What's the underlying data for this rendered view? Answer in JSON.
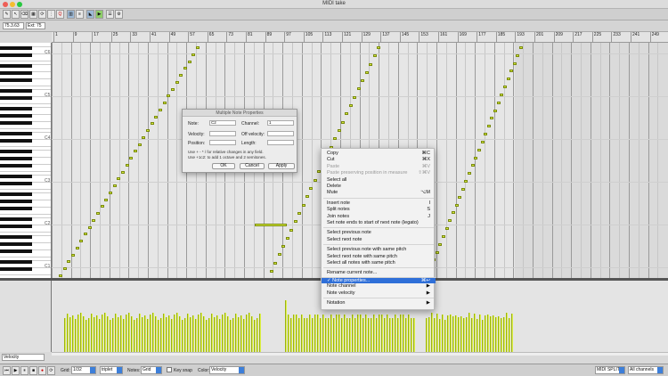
{
  "window": {
    "title": "MIDI take"
  },
  "infobar": {
    "position": "75.3.63",
    "length": "Ext: 75"
  },
  "ruler": {
    "labels": [
      "1",
      "9",
      "17",
      "25",
      "33",
      "41",
      "49",
      "57",
      "65",
      "73",
      "81",
      "89",
      "97",
      "105",
      "113",
      "121",
      "129",
      "137",
      "145",
      "153",
      "161",
      "169",
      "177",
      "185",
      "193",
      "201",
      "209",
      "217",
      "225",
      "233",
      "241",
      "249"
    ]
  },
  "piano": {
    "octaves": [
      "C6",
      "C5",
      "C4",
      "C3",
      "C2",
      "C1"
    ]
  },
  "dialog": {
    "title": "Multiple Note Properties",
    "note_label": "Note:",
    "note_value": "C2",
    "channel_label": "Channel:",
    "channel_value": "1",
    "velocity_label": "Velocity:",
    "off_velocity_label": "Off velocity:",
    "position_label": "Position:",
    "length_label": "Length:",
    "hint1": "Use + - * / for relative changes in any field.",
    "hint2": "Use +1c2: to add 1 octave and 2 semitones.",
    "ok": "OK",
    "cancel": "Cancel",
    "apply": "Apply"
  },
  "menu": {
    "items": [
      {
        "label": "Copy",
        "shortcut": "⌘C"
      },
      {
        "label": "Cut",
        "shortcut": "⌘X"
      },
      {
        "label": "Paste",
        "shortcut": "⌘V",
        "disabled": true
      },
      {
        "label": "Paste preserving position in measure",
        "shortcut": "⇧⌘V",
        "disabled": true
      },
      {
        "label": "Select all",
        "shortcut": ""
      },
      {
        "label": "Delete",
        "shortcut": ""
      },
      {
        "label": "Mute",
        "shortcut": "⌥M"
      },
      {
        "label": "Insert note",
        "shortcut": "I"
      },
      {
        "label": "Split notes",
        "shortcut": "S"
      },
      {
        "label": "Join notes",
        "shortcut": "J"
      },
      {
        "label": "Set note ends to start of next note (legato)",
        "shortcut": ""
      },
      {
        "label": "Select previous note",
        "shortcut": ""
      },
      {
        "label": "Select next note",
        "shortcut": ""
      },
      {
        "label": "Select previous note with same pitch",
        "shortcut": ""
      },
      {
        "label": "Select next note with same pitch",
        "shortcut": ""
      },
      {
        "label": "Select all notes with same pitch",
        "shortcut": ""
      },
      {
        "label": "Rename current note...",
        "shortcut": ""
      },
      {
        "label": "✓ Note properties...",
        "shortcut": "⌘↩",
        "highlighted": true
      },
      {
        "label": "Note channel",
        "shortcut": "▶"
      },
      {
        "label": "Note velocity",
        "shortcut": "▶"
      },
      {
        "label": "Notation",
        "shortcut": "▶"
      }
    ]
  },
  "velocity_lane": {
    "label": "Velocity"
  },
  "bottombar": {
    "grid_label": "Grid:",
    "grid_value": "1/32",
    "grid_type": "triplet",
    "notes_label": "Notes:",
    "notes_value": "Grid",
    "key_snap": "Key snap",
    "color_label": "Color:",
    "color_value": "Velocity",
    "midi_mode": "MIDI SPLITS",
    "channels": "All channels"
  },
  "colors": {
    "note": "#d6ec3a",
    "velocity": "#dff24a",
    "highlight": "#2f6fd8"
  }
}
